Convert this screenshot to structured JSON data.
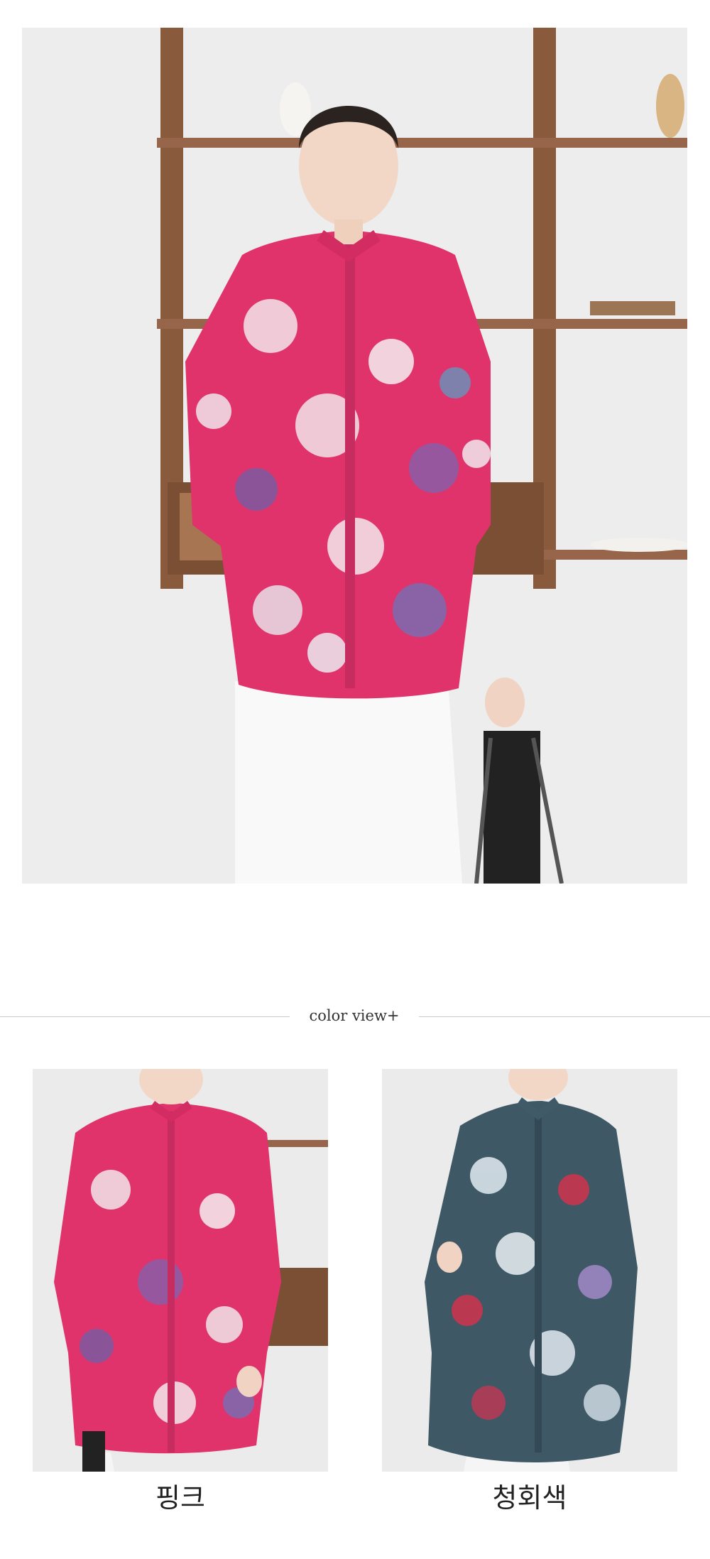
{
  "section_title": "color view+",
  "colors": [
    {
      "label": "핑크",
      "swatch": "#e0336c"
    },
    {
      "label": "청회색",
      "swatch": "#3f5866"
    }
  ],
  "palette": {
    "background": "#ffffff",
    "photo_backdrop": "#ebebec",
    "shelf_wood": "#8a5a3c",
    "divider_line": "#c9c9c9"
  }
}
